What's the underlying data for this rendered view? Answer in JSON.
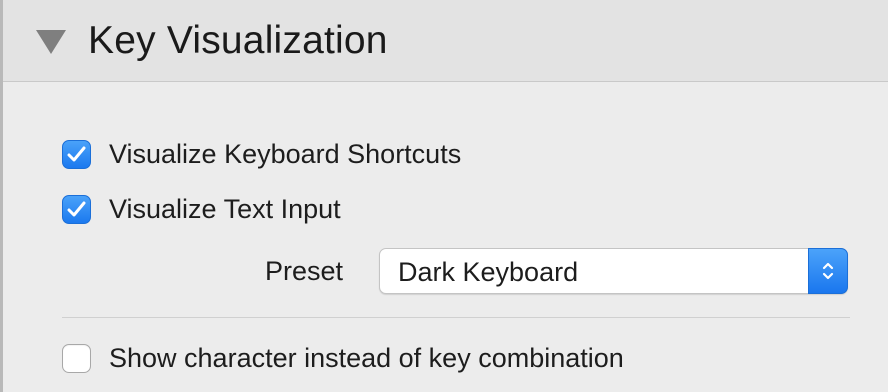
{
  "header": {
    "title": "Key Visualization",
    "disclosure_icon": "disclosure-triangle-down-icon"
  },
  "options": {
    "visualize_shortcuts": {
      "label": "Visualize Keyboard Shortcuts",
      "checked": true
    },
    "visualize_text": {
      "label": "Visualize Text Input",
      "checked": true
    },
    "show_character": {
      "label": "Show character instead of key combination",
      "checked": false
    }
  },
  "preset": {
    "label": "Preset",
    "value": "Dark Keyboard",
    "stepper_icon": "chevron-up-down-icon"
  },
  "colors": {
    "accent": "#1b79ef",
    "background": "#ececec",
    "header_background": "#e3e3e3"
  }
}
